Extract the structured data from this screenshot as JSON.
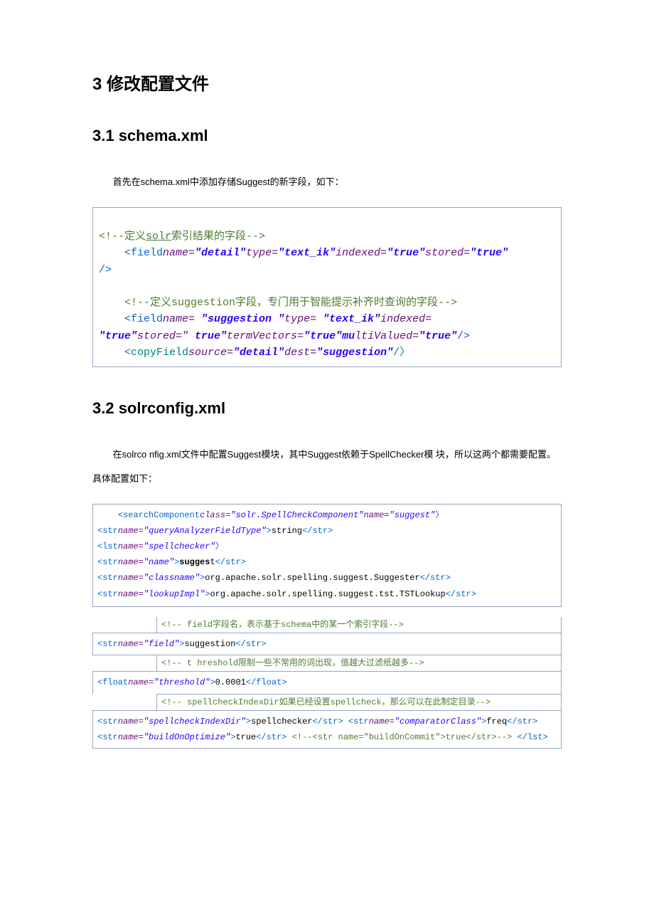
{
  "h2": "3 修改配置文件",
  "s31": {
    "title": "3.1 schema.xml",
    "para": "首先在schema.xml中添加存储Suggest的新字段，如下：",
    "code": {
      "c0a": "<!--定义",
      "c0b": "solr",
      "c0c": "索引结果的字段-->",
      "c1_open": "<field",
      "c1_name_kw": "name=",
      "c1_name_val": "\"detail\"",
      "c1_type_kw": "type=",
      "c1_type_val": "\"text_ik\"",
      "c1_idx_kw": "indexed=",
      "c1_idx_val": "\"true\"",
      "c1_st_kw": "stored=",
      "c1_st_val": "\"true\"",
      "c1_close": "/>",
      "c2": "<!--定义suggestion字段，专门用于智能提示补齐时查询的字段-->",
      "c3_open": "<field",
      "c3_name_kw": "name= ",
      "c3_name_val": "\"suggestion \"",
      "c3_type_kw": "type= ",
      "c3_type_val": "\"text_ik\"",
      "c3_idx_kw": "indexed=",
      "c3_idx_val": "\"true\"",
      "c3_st_kw": "stored=\" ",
      "c3_st_val": "true\"",
      "c3_tv_kw": "termVectors=",
      "c3_tv_val": "\"true\"",
      "c3_mv_kw": "mu",
      "c3_mv_kw2": "ltiValued=",
      "c3_mv_val": "\"true\"",
      "c3_close": "/>",
      "c4_open": "<copyField",
      "c4_src_kw": "source=",
      "c4_src_val": "\"detail\"",
      "c4_dst_kw": "dest=",
      "c4_dst_val": "\"suggestion\"",
      "c4_close": "/〉"
    }
  },
  "s32": {
    "title": "3.2 solrconfig.xml",
    "para": "在solrco nfig.xml文件中配置Suggest模块，其中Suggest依赖于SpellChecker模 块，所以这两个都需要配置。具体配置如下：",
    "code": {
      "l1_a": "<searchComponent",
      "l1_b": "class=",
      "l1_c": "\"solr.SpellCheckComponent\"",
      "l1_d": "name=",
      "l1_e": "\"suggest\"",
      "l1_f": "〉",
      "l2_a": "<str",
      "l2_b": "name=",
      "l2_c": "\"queryAnalyzerFieldType\"",
      "l2_d": ">",
      "l2_e": "string",
      "l2_f": "</str>",
      "l3_a": "<lst",
      "l3_b": "name=",
      "l3_c": "\"spellchecker\"",
      "l3_d": "〉",
      "l4_a": "<str",
      "l4_b": "name=",
      "l4_c": "\"name\"",
      "l4_d": ">",
      "l4_e": "sugges",
      "l4_f": "t",
      "l4_g": "</str>",
      "l5_a": "<str",
      "l5_b": "name=",
      "l5_c": "\"classname\"",
      "l5_d": ">",
      "l5_e": "org.apache.solr.spelling.suggest.Suggester",
      "l5_f": "</str>",
      "l6_a": "<str",
      "l6_b": "name=",
      "l6_c": "\"lookupImpl\"",
      "l6_d": ">",
      "l6_e": "org.apache.solr.spelling.suggest.tst.TSTLookup",
      "l6_f": "</str>",
      "hc1": "<!-- field字段名，表示基于schema中的某一个索引字段-->",
      "l7_a": "<str",
      "l7_b": "name=",
      "l7_c": "\"field\"",
      "l7_d": ">",
      "l7_e": "suggestion",
      "l7_f": "</str>",
      "hc2": "<!-- t hreshold限制一些不常用的词出现，值越大过滤纸越多-->",
      "l8_a": "<float",
      "l8_b": "name=",
      "l8_c": "\"threshold\"",
      "l8_d": ">",
      "l8_e": "0.0001",
      "l8_f": "</float>",
      "hc3": "<!-- spellcheckIndexDir如果已经设置spellcheck，那么可以在此制定目录-->",
      "l9_a": "<str",
      "l9_b": "name=",
      "l9_c": "\"spellcheckIndexDir\"",
      "l9_d": ">",
      "l9_e": "spellchecker",
      "l9_f": "</str>",
      "l10_a": "<str",
      "l10_b": "name=",
      "l10_c": "\"comparatorClass\"",
      "l10_d": ">",
      "l10_e": "freq",
      "l10_f": "</str>",
      "l11_a": "<str",
      "l11_b": "name=",
      "l11_c": "\"buildOnOptimize\"",
      "l11_d": ">",
      "l11_e": "true",
      "l11_f": "</str>",
      "l12": "<!--<str name=\"buildOnCommit\">true</str>-->",
      "l13": "</lst>"
    }
  }
}
